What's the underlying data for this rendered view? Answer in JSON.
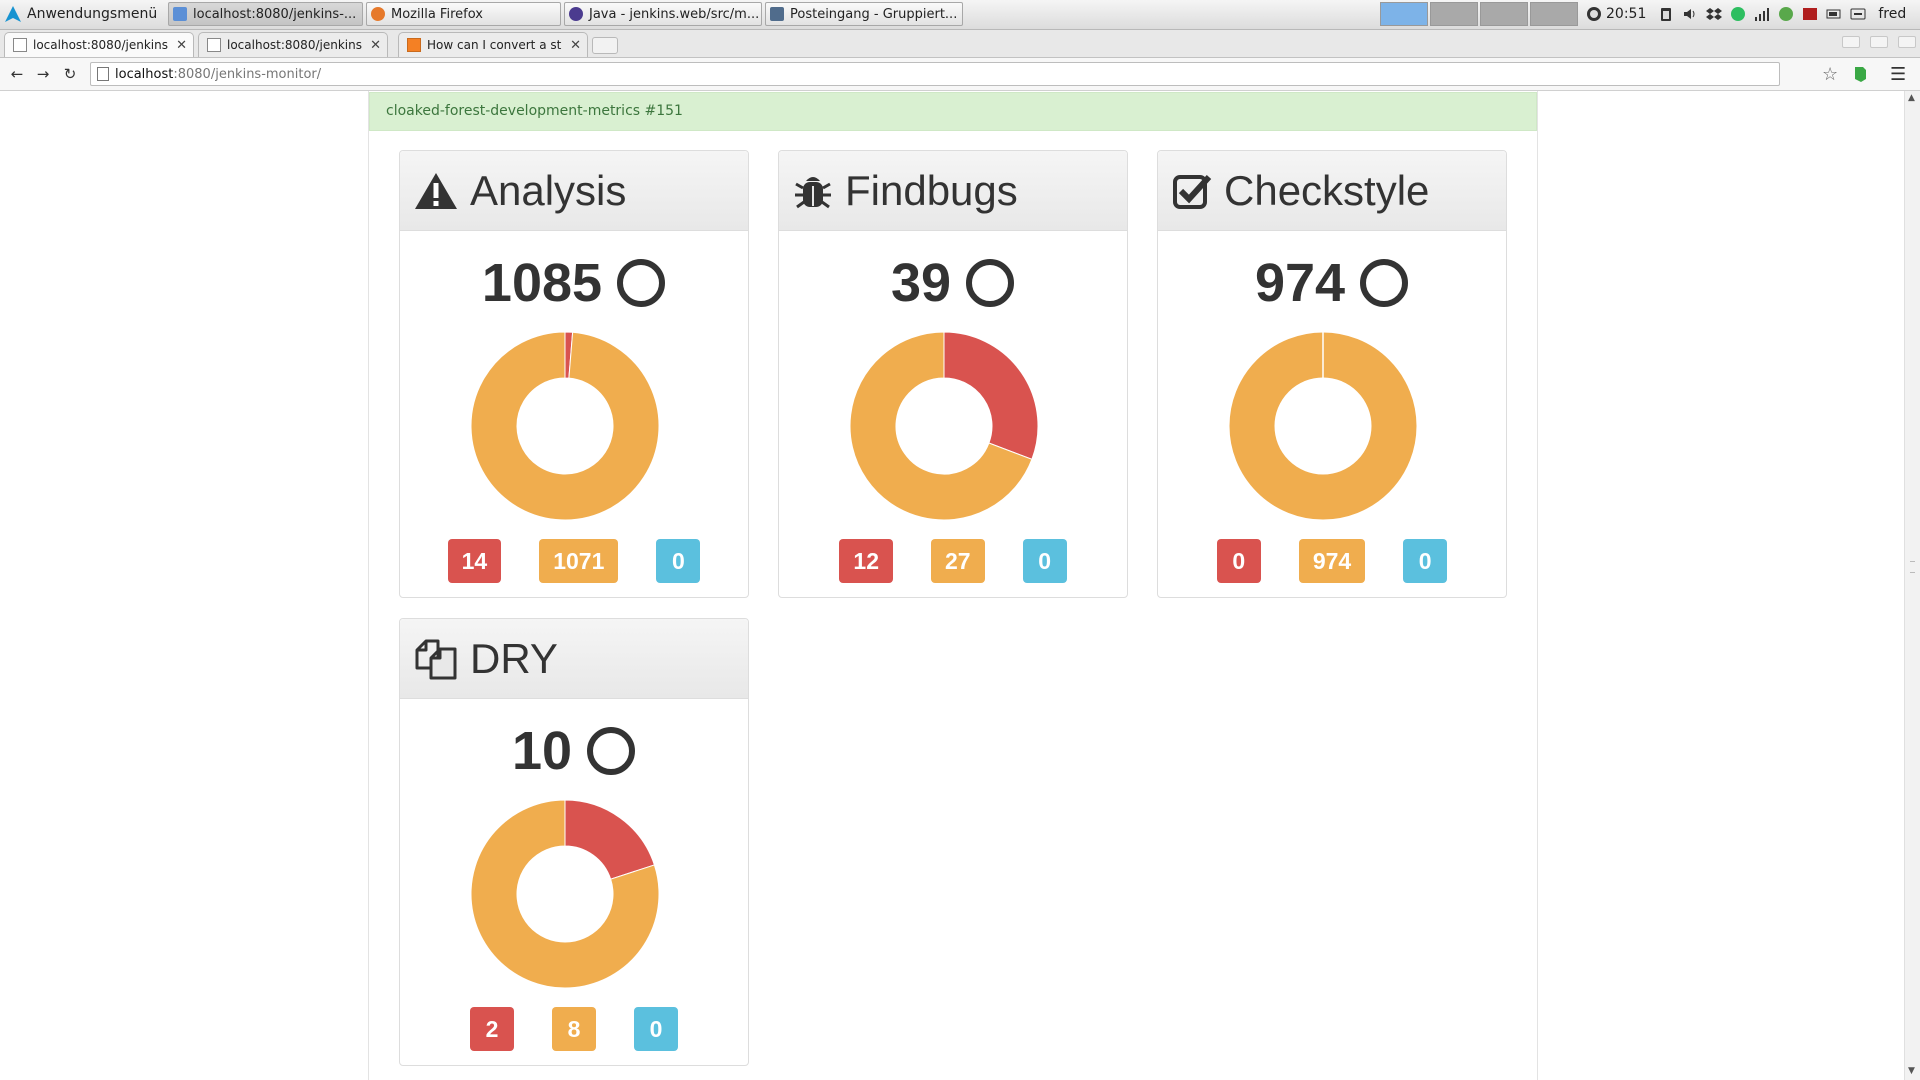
{
  "taskbar": {
    "app_menu": "Anwendungsmenü",
    "windows": [
      {
        "label": "localhost:8080/jenkins-...",
        "active": true
      },
      {
        "label": "Mozilla Firefox",
        "active": false
      },
      {
        "label": "Java - jenkins.web/src/m...",
        "active": false
      },
      {
        "label": "Posteingang - Gruppiert...",
        "active": false
      }
    ],
    "clock": "20:51",
    "user": "fred"
  },
  "browser": {
    "tabs": [
      {
        "label": "localhost:8080/jenkins"
      },
      {
        "label": "localhost:8080/jenkins"
      },
      {
        "label": "How can I convert a st"
      }
    ],
    "url_host": "localhost",
    "url_rest": ":8080/jenkins-monitor/"
  },
  "page": {
    "status": "cloaked-forest-development-metrics #151",
    "panels": [
      {
        "title": "Analysis",
        "icon": "warning-icon",
        "total": "1085",
        "high": "14",
        "normal": "1071",
        "low": "0"
      },
      {
        "title": "Findbugs",
        "icon": "bug-icon",
        "total": "39",
        "high": "12",
        "normal": "27",
        "low": "0"
      },
      {
        "title": "Checkstyle",
        "icon": "check-square-icon",
        "total": "974",
        "high": "0",
        "normal": "974",
        "low": "0"
      },
      {
        "title": "DRY",
        "icon": "copy-icon",
        "total": "10",
        "high": "2",
        "normal": "8",
        "low": "0"
      }
    ]
  },
  "colors": {
    "high": "#d9534f",
    "normal": "#f0ad4e",
    "low": "#5bc0de",
    "success_bg": "#dff0d8"
  }
}
